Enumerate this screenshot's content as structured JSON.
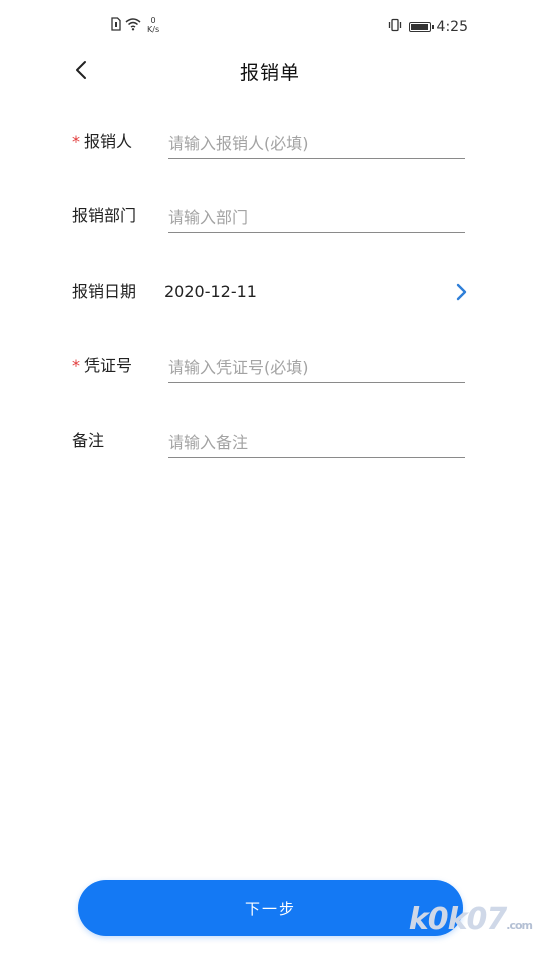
{
  "status_bar": {
    "net_speed_value": "0",
    "net_speed_unit": "K/s",
    "time": "4:25",
    "battery_level": 0.85
  },
  "header": {
    "title": "报销单"
  },
  "form": {
    "applicant": {
      "required_mark": "*",
      "label": "报销人",
      "placeholder": "请输入报销人(必填)",
      "value": ""
    },
    "department": {
      "label": "报销部门",
      "placeholder": "请输入部门",
      "value": ""
    },
    "date": {
      "label": "报销日期",
      "value": "2020-12-11"
    },
    "voucher": {
      "required_mark": "*",
      "label": "凭证号",
      "placeholder": "请输入凭证号(必填)",
      "value": ""
    },
    "remark": {
      "label": "备注",
      "placeholder": "请输入备注",
      "value": ""
    }
  },
  "footer": {
    "next_label": "下一步"
  },
  "watermark": {
    "text": "k0k07",
    "suffix": ".com"
  },
  "colors": {
    "accent": "#1479f4",
    "required": "#e23b3b",
    "chevron": "#2f7fd8"
  },
  "icons": {
    "sim": "sim-card-icon",
    "wifi": "wifi-icon",
    "vibrate": "vibrate-icon",
    "battery": "battery-icon",
    "back": "chevron-left-icon",
    "date_arrow": "chevron-right-icon"
  }
}
